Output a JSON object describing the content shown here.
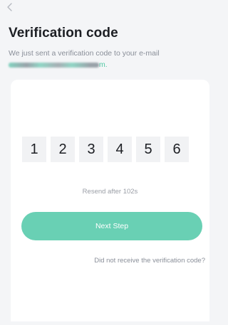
{
  "nav": {
    "back_icon": "chevron-left-icon"
  },
  "header": {
    "title": "Verification code",
    "subtitle": "We just sent a verification code to your e-mail",
    "email_suffix": "m."
  },
  "code": {
    "digits": [
      "1",
      "2",
      "3",
      "4",
      "5",
      "6"
    ]
  },
  "resend_text": "Resend after 102s",
  "next_button_label": "Next Step",
  "help_link": "Did not receive the verification code?",
  "colors": {
    "accent": "#69d0b4",
    "background": "#f4f5f7",
    "card": "#ffffff",
    "code_box": "#f1f2f4"
  }
}
